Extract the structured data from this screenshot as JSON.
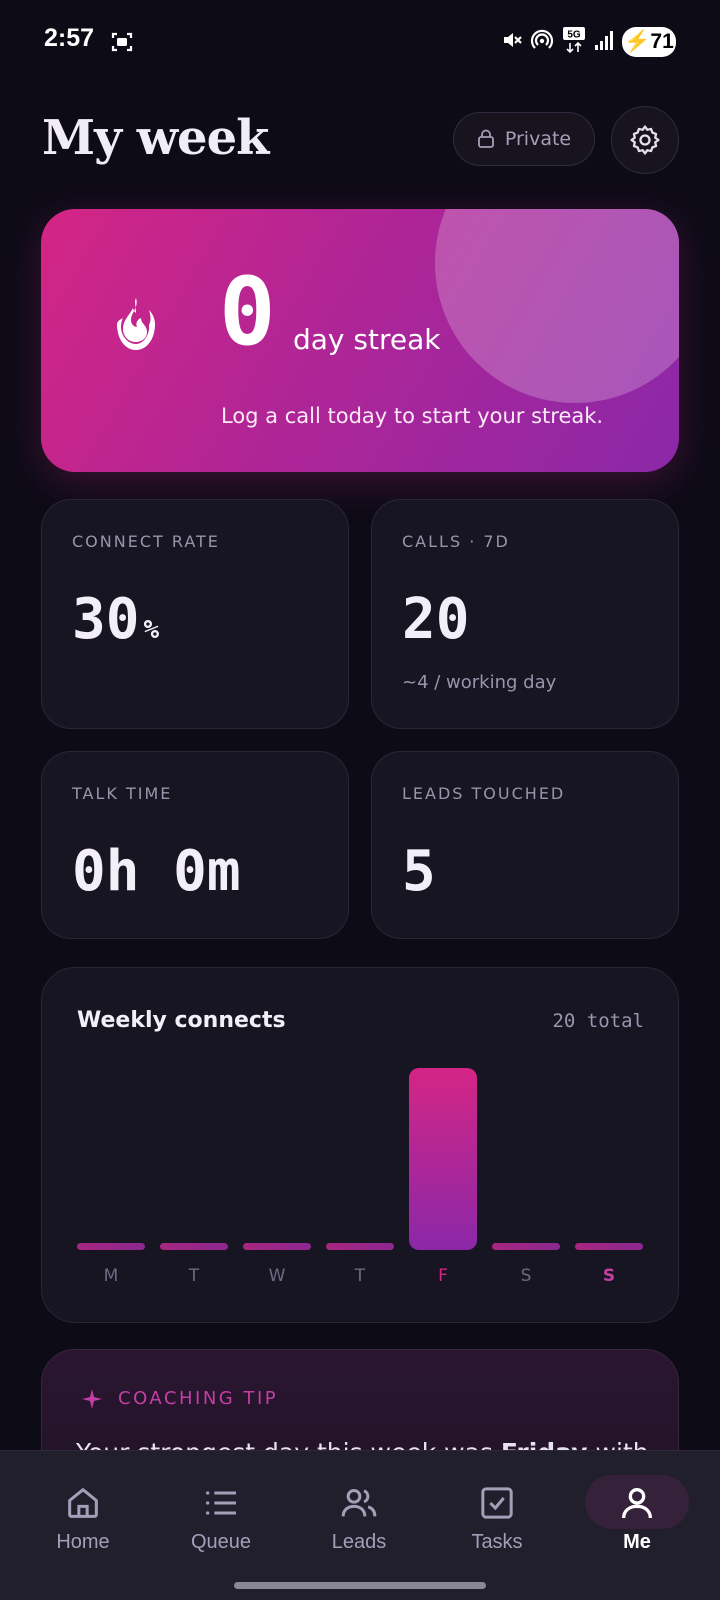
{
  "status_bar": {
    "time": "2:57",
    "battery": "71"
  },
  "header": {
    "title": "My week",
    "privacy_label": "Private"
  },
  "streak": {
    "count": "0",
    "unit_label": "day streak",
    "hint": "Log a call today to start your streak."
  },
  "stats": [
    {
      "label": "CONNECT RATE",
      "value": "30",
      "unit": "%",
      "sub": ""
    },
    {
      "label": "CALLS · 7D",
      "value": "20",
      "unit": "",
      "sub": "~4 / working day"
    },
    {
      "label": "TALK TIME",
      "value": "0h 0m",
      "unit": "",
      "sub": ""
    },
    {
      "label": "LEADS TOUCHED",
      "value": "5",
      "unit": "",
      "sub": ""
    }
  ],
  "chart_data": {
    "type": "bar",
    "title": "Weekly connects",
    "total_label": "20 total",
    "categories": [
      "M",
      "T",
      "W",
      "T",
      "F",
      "S",
      "S"
    ],
    "values": [
      0,
      0,
      0,
      0,
      20,
      0,
      0
    ],
    "highlight_index": 4,
    "today_index": 6,
    "ylim": [
      0,
      20
    ],
    "colors": {
      "bar_top": "#d42585",
      "bar_bottom": "#8b28a8",
      "label": "#6f6984",
      "highlight_label": "#d42585",
      "today_label": "#c33fa4"
    }
  },
  "coaching_tip": {
    "label": "COACHING TIP",
    "text_before": "Your strongest day this week was ",
    "text_bold": "Friday",
    "text_after": " with"
  },
  "nav": {
    "items": [
      {
        "label": "Home",
        "icon": "home-icon"
      },
      {
        "label": "Queue",
        "icon": "list-icon"
      },
      {
        "label": "Leads",
        "icon": "users-icon"
      },
      {
        "label": "Tasks",
        "icon": "checkbox-icon"
      },
      {
        "label": "Me",
        "icon": "user-icon"
      }
    ],
    "active_index": 4
  },
  "colors": {
    "background": "#0d0b16",
    "card": "#181522",
    "accent": "#d42585",
    "accent_purple": "#8b28a8"
  }
}
